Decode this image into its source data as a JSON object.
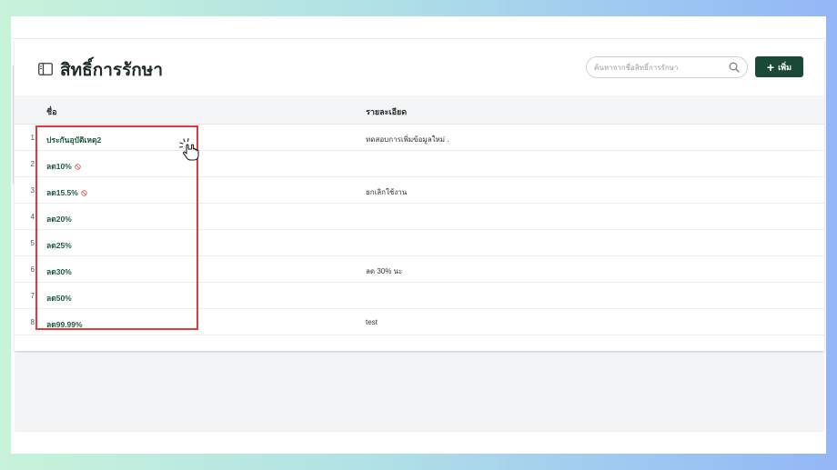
{
  "page": {
    "title": "สิทธิ์การรักษา"
  },
  "search": {
    "placeholder": "ค้นหาจากชื่อสิทธิ์การรักษา"
  },
  "toolbar": {
    "add_label": "เพิ่ม",
    "add_icon": "plus-icon"
  },
  "table": {
    "columns": [
      "ชื่อ",
      "รายละเอียด"
    ],
    "rows": [
      {
        "index": "1",
        "name": "ประกันอุบัติเหตุ2",
        "detail": "ทดสอบการเพิ่มข้อมูลใหม่ .",
        "disabled": false
      },
      {
        "index": "2",
        "name": "ลด10%",
        "detail": "",
        "disabled": true
      },
      {
        "index": "3",
        "name": "ลด15.5%",
        "detail": "ยกเลิกใช้งาน",
        "disabled": true
      },
      {
        "index": "4",
        "name": "ลด20%",
        "detail": "",
        "disabled": false
      },
      {
        "index": "5",
        "name": "ลด25%",
        "detail": "",
        "disabled": false
      },
      {
        "index": "6",
        "name": "ลด30%",
        "detail": "ลด 30% นะ",
        "disabled": false
      },
      {
        "index": "7",
        "name": "ลด50%",
        "detail": "",
        "disabled": false
      },
      {
        "index": "8",
        "name": "ลด99.99%",
        "detail": "test",
        "disabled": false
      }
    ]
  },
  "colors": {
    "accent": "#1a4a36",
    "link": "#1f5a3f",
    "highlight": "#e23a3a",
    "disabled_icon": "#e05555"
  },
  "icons": {
    "title": "sidebar-panel-icon",
    "search": "search-icon",
    "disabled": "ban-icon",
    "cursor": "hand-pointer-icon"
  }
}
